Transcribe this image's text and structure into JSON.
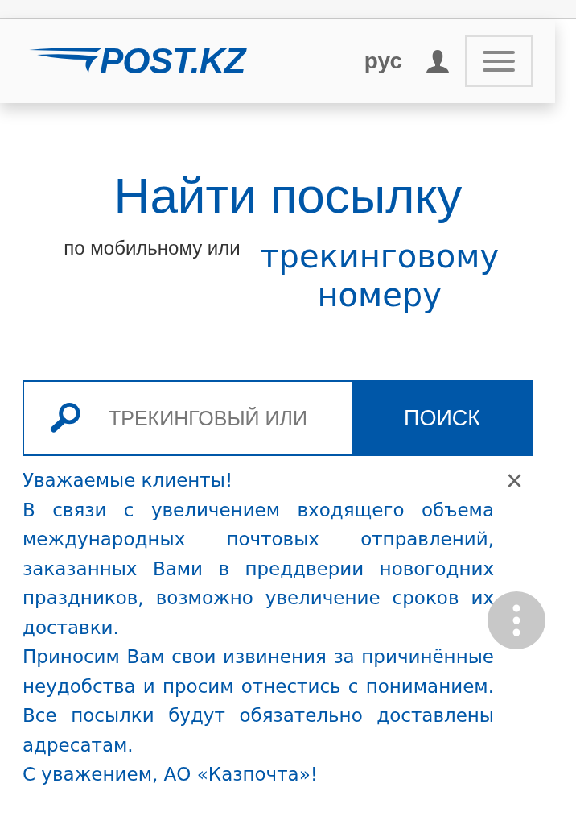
{
  "header": {
    "logo": "POST.KZ",
    "language": "рус"
  },
  "hero": {
    "title": "Найти посылку",
    "subtitle": "по мобильному или",
    "subtitle_emphasis": "трекинговому номеру"
  },
  "search": {
    "placeholder": "ТРЕКИНГОВЫЙ ИЛИ",
    "button": "ПОИСК"
  },
  "notice": {
    "title": "Уважаемые клиенты!",
    "close": "×",
    "paragraphs": [
      "В связи с увеличением входящего объема международных почтовых отправлений, заказанных Вами в преддверии новогодних праздников, возможно увеличение сроков их доставки.",
      "Приносим Вам свои извинения за причинённые неудобства и просим отнестись с пониманием. Все посылки будут обязательно доставлены адресатам."
    ],
    "signature": "С уважением, АО «Казпочта»!"
  }
}
